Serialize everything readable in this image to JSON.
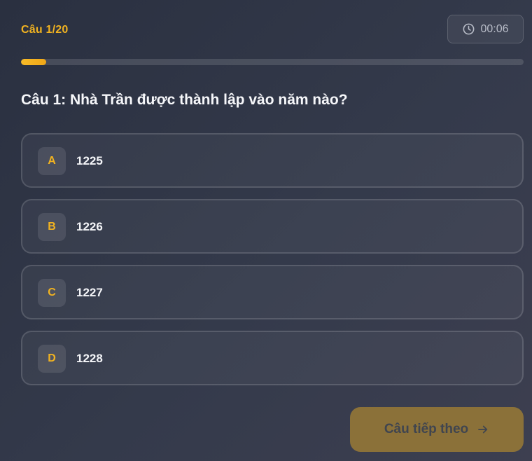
{
  "header": {
    "counter": "Câu 1/20",
    "timer": "00:06",
    "timer_icon": "clock-icon"
  },
  "progress": {
    "fraction": 0.05
  },
  "question": {
    "text": "Câu 1: Nhà Trần được thành lập vào năm nào?"
  },
  "options": [
    {
      "letter": "A",
      "text": "1225"
    },
    {
      "letter": "B",
      "text": "1226"
    },
    {
      "letter": "C",
      "text": "1227"
    },
    {
      "letter": "D",
      "text": "1228"
    }
  ],
  "next_button": {
    "label": "Câu tiếp theo",
    "icon": "arrow-right-icon"
  },
  "colors": {
    "accent": "#f2b320",
    "next_button_disabled": "#8b7139"
  }
}
